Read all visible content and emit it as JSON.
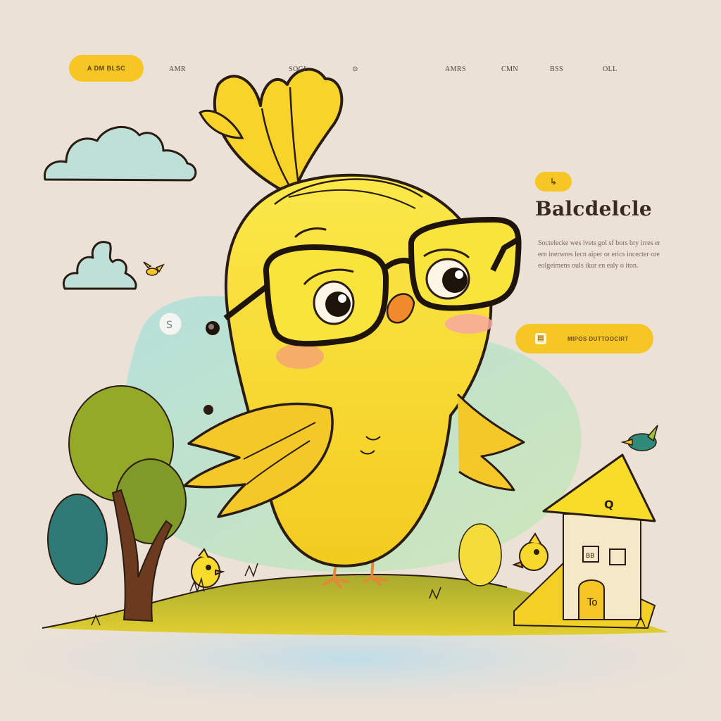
{
  "nav": {
    "pill_label": "A DM BLSC",
    "links": [
      "AMR",
      "SOGL",
      "⊙",
      "AMRS",
      "CMN",
      "BSS",
      "OLL"
    ]
  },
  "hero": {
    "tag": "↳",
    "title": "Balcdelcle",
    "description": "Soctelecke wes ivets gol sf bors bry irres er ern inerwres lecn aiper or erics incecter ore eolgeimens ouls ikur en ealy o iton.",
    "cta_label": "MIPOS DUTTOOCIRT",
    "cta_icon": "document-icon"
  },
  "illustration": {
    "house_door_text": "To",
    "house_roof_text": "Q",
    "house_window_text": "BB",
    "bubble_text": "S"
  },
  "colors": {
    "background": "#ece1d6",
    "accent_yellow": "#f6c724",
    "chick_yellow": "#f8e12a",
    "outline": "#2a1c12",
    "cloud": "#bfe0d8",
    "grass": "#9aa52a"
  }
}
